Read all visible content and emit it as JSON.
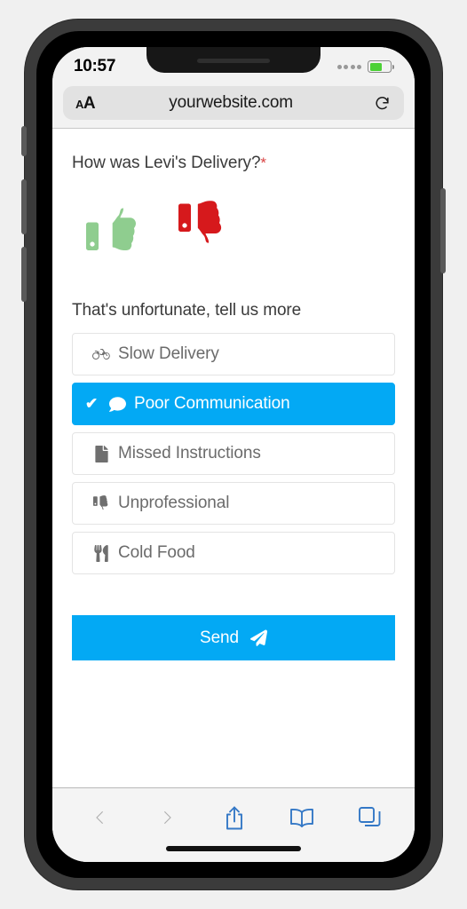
{
  "device": {
    "status_bar": {
      "time": "10:57",
      "signal_dots": 4,
      "battery_level_pct": 62
    }
  },
  "browser": {
    "text_size_small": "A",
    "text_size_large": "A",
    "url": "yourwebsite.com",
    "reload_icon": "reload-icon",
    "toolbar": {
      "back_icon": "chevron-left-icon",
      "forward_icon": "chevron-right-icon",
      "share_icon": "share-icon",
      "bookmarks_icon": "book-icon",
      "tabs_icon": "tabs-icon"
    }
  },
  "page": {
    "question": "How was Levi's Delivery?",
    "required_mark": "*",
    "rating": {
      "thumbs_up": {
        "icon": "thumbs-up-icon",
        "color": "#8fcd8f",
        "selected": false
      },
      "thumbs_down": {
        "icon": "thumbs-down-icon",
        "color": "#d6191c",
        "selected": true
      }
    },
    "followup_title": "That's unfortunate, tell us more",
    "options": [
      {
        "label": "Slow Delivery",
        "icon": "bicycle-icon",
        "selected": false
      },
      {
        "label": "Poor Communication",
        "icon": "speech-bubble-icon",
        "selected": true
      },
      {
        "label": "Missed Instructions",
        "icon": "document-icon",
        "selected": false
      },
      {
        "label": "Unprofessional",
        "icon": "thumbs-down-icon",
        "selected": false
      },
      {
        "label": "Cold Food",
        "icon": "fork-knife-icon",
        "selected": false
      }
    ],
    "check_mark": "✔",
    "send": {
      "label": "Send",
      "icon": "paper-plane-icon"
    },
    "accent_color": "#03a9f4"
  }
}
